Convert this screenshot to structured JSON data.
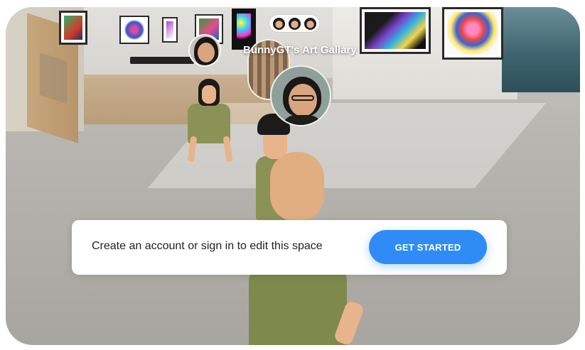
{
  "space": {
    "title": "BunnyGT's Art Gallary"
  },
  "participants_pill": {
    "avatars": [
      "participant-avatar",
      "participant-avatar",
      "participant-avatar"
    ]
  },
  "banner": {
    "message": "Create an account or sign in to edit this space",
    "cta_label": "GET STARTED"
  },
  "colors": {
    "cta_blue": "#2f8cf5",
    "banner_bg": "#ffffff",
    "shirt_olive": "#8a9256"
  }
}
